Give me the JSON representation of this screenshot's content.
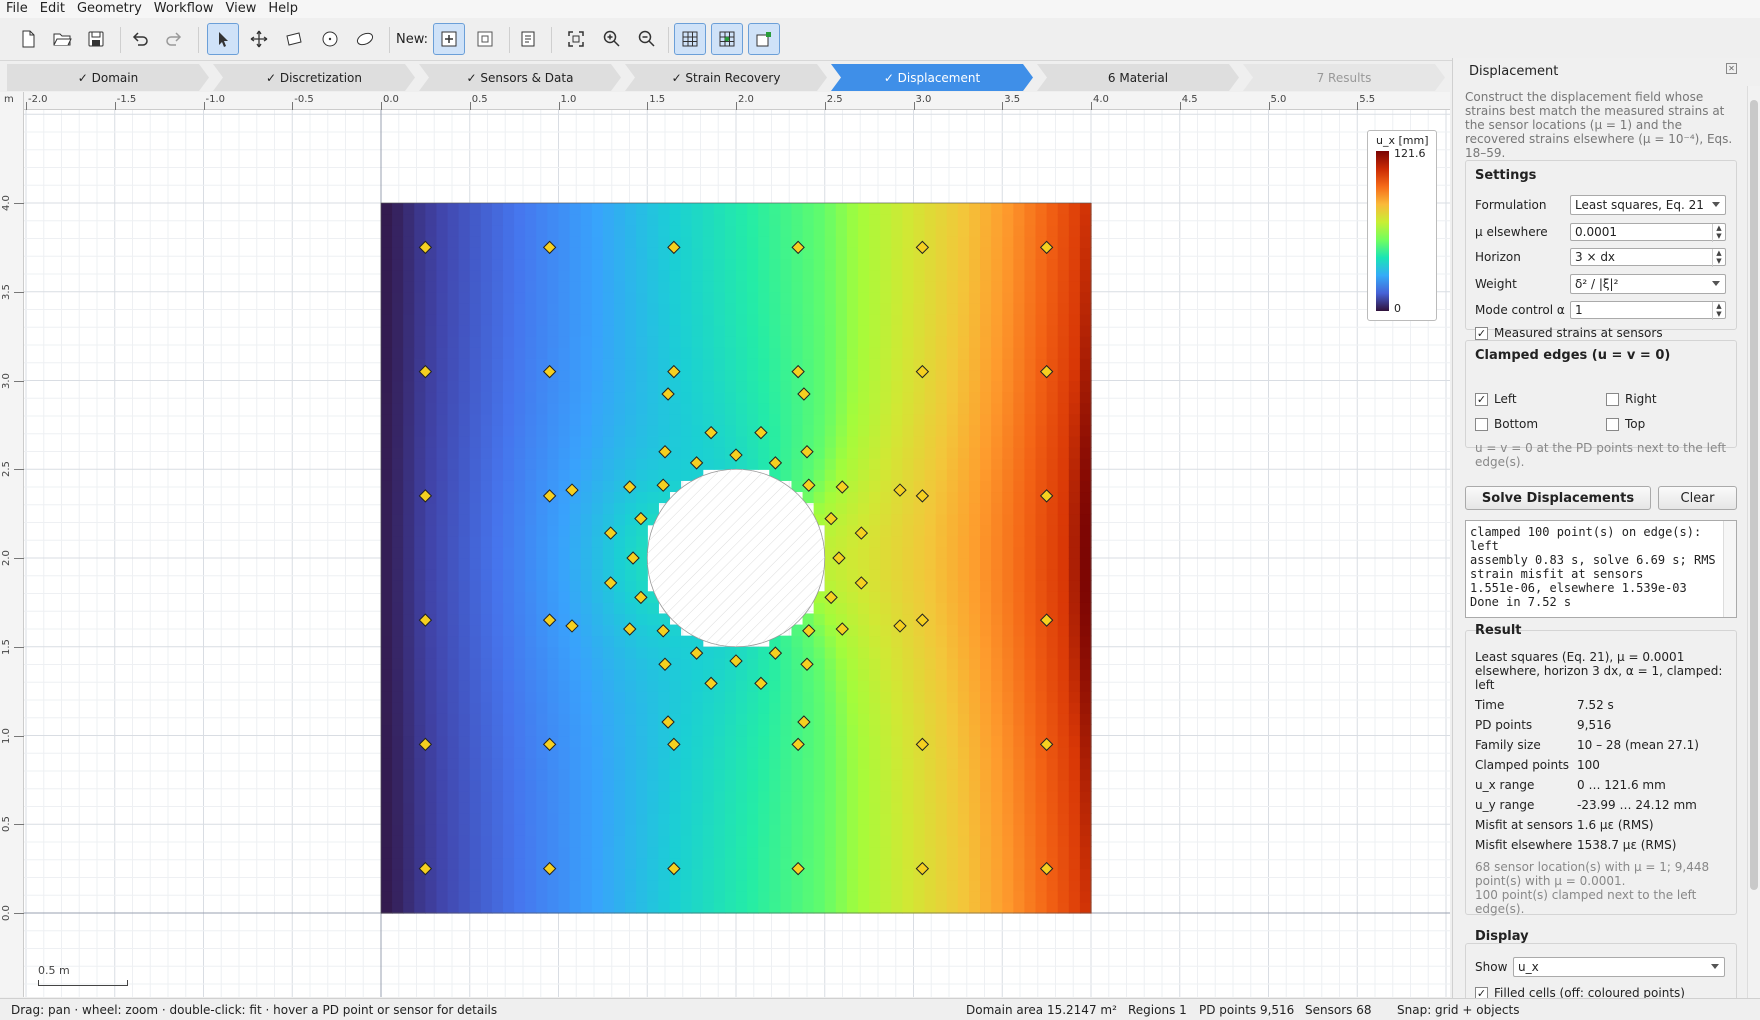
{
  "menu": [
    "File",
    "Edit",
    "Geometry",
    "Workflow",
    "View",
    "Help"
  ],
  "toolbar": {
    "new_label": "New:"
  },
  "wizard": [
    {
      "label": "✓  Domain",
      "state": "done"
    },
    {
      "label": "✓  Discretization",
      "state": "done"
    },
    {
      "label": "✓  Sensors & Data",
      "state": "done"
    },
    {
      "label": "✓  Strain Recovery",
      "state": "done"
    },
    {
      "label": "✓  Displacement",
      "state": "current"
    },
    {
      "label": "6  Material",
      "state": "next"
    },
    {
      "label": "7  Results",
      "state": "future"
    }
  ],
  "ruler": {
    "x_ticks": [
      "-2.0",
      "-1.5",
      "-1.0",
      "-0.5",
      "0.0",
      "0.5",
      "1.0",
      "1.5",
      "2.0",
      "2.5",
      "3.0",
      "3.5",
      "4.0",
      "4.5",
      "5.0",
      "5.5"
    ],
    "y_ticks": [
      "4.0",
      "3.5",
      "3.0",
      "2.5",
      "2.0",
      "1.5",
      "1.0",
      "0.5",
      "0.0"
    ],
    "unit": "m"
  },
  "legend": {
    "title": "u_x [mm]",
    "max": "121.6",
    "min": "0"
  },
  "scalebar": "0.5 m",
  "field": {
    "x_range": [
      0,
      4.0
    ],
    "y_range": [
      0,
      4.0
    ],
    "hole_center": [
      2.0,
      2.0
    ],
    "hole_radius": 0.5,
    "u_x_max": 121.6
  },
  "sensors": {
    "x": [
      0.25,
      0.95,
      1.65,
      2.35,
      3.05,
      3.75
    ],
    "y": [
      0.25,
      0.95,
      1.65,
      2.35,
      3.05,
      3.75
    ]
  },
  "panel": {
    "title": "Displacement",
    "close": "✕",
    "description": "Construct the displacement field whose strains best match the measured strains at the sensor locations (μ = 1) and the recovered strains elsewhere (μ = 10⁻⁴), Eqs. 18–59.",
    "settings": {
      "title": "Settings",
      "formulation_label": "Formulation",
      "formulation": "Least squares, Eq. 21",
      "mu_label": "μ elsewhere",
      "mu": "0.0001",
      "horizon_label": "Horizon",
      "horizon": "3 × dx",
      "weight_label": "Weight",
      "weight": "δ² / |ξ|²",
      "alpha_label": "Mode control α",
      "alpha": "1",
      "measured_label": "Measured strains at sensors"
    },
    "clamped": {
      "title": "Clamped edges (u = v = 0)",
      "left": "Left",
      "right": "Right",
      "bottom": "Bottom",
      "top": "Top",
      "hint": "u = v = 0 at the PD points next to the left edge(s)."
    },
    "solve_label": "Solve Displacements",
    "clear_label": "Clear",
    "log": "clamped 100 point(s) on edge(s):\nleft\nassembly 0.83 s, solve 6.69 s; RMS\nstrain misfit at sensors\n1.551e-06, elsewhere 1.539e-03\nDone in 7.52 s",
    "result": {
      "title": "Result",
      "summary": "Least squares (Eq. 21), μ = 0.0001 elsewhere, horizon 3 dx, α = 1, clamped: left",
      "rows": [
        {
          "k": "Time",
          "v": "7.52 s"
        },
        {
          "k": "PD points",
          "v": "9,516"
        },
        {
          "k": "Family size",
          "v": "10 – 28 (mean 27.1)"
        },
        {
          "k": "Clamped points",
          "v": "100"
        },
        {
          "k": "u_x range",
          "v": "0 … 121.6 mm"
        },
        {
          "k": "u_y range",
          "v": "-23.99 … 24.12 mm"
        },
        {
          "k": "Misfit at sensors",
          "v": "1.6 με (RMS)"
        },
        {
          "k": "Misfit elsewhere",
          "v": "1538.7 με (RMS)"
        }
      ],
      "note": "68 sensor location(s) with μ = 1; 9,448 point(s) with μ = 0.0001.\n100 point(s) clamped next to the left edge(s)."
    },
    "display": {
      "title": "Display",
      "show_label": "Show",
      "show": "u_x",
      "filled_label": "Filled cells (off: coloured points)"
    }
  },
  "status": {
    "hint": "Drag: pan · wheel: zoom · double-click: fit · hover a PD point or sensor for details",
    "area": "Domain area 15.2147 m²",
    "regions": "Regions 1",
    "points": "PD points 9,516",
    "sensors": "Sensors 68",
    "snap": "Snap: grid + objects"
  }
}
